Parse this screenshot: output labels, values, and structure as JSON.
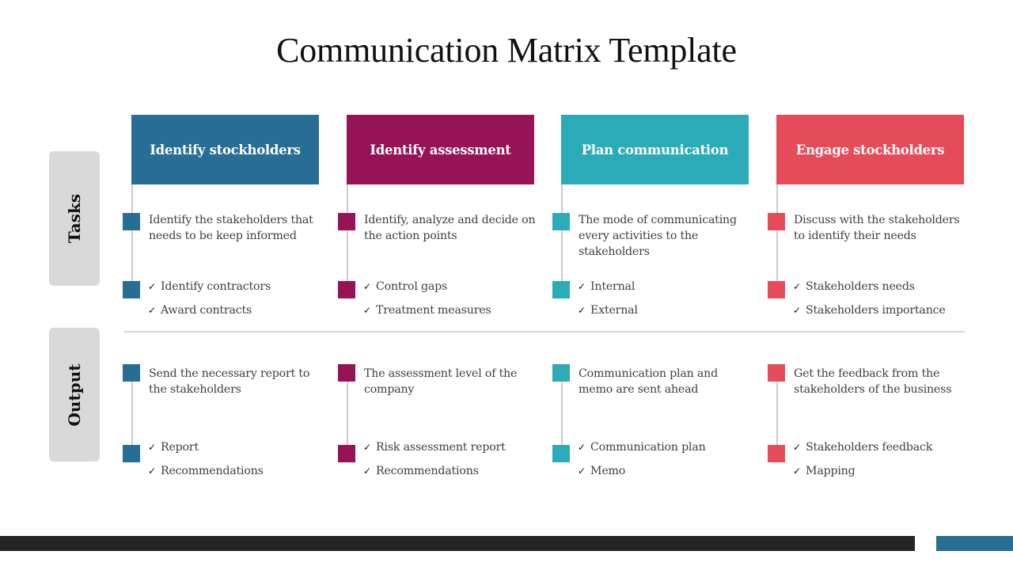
{
  "title": "Communication Matrix Template",
  "row_labels": {
    "tasks": "Tasks",
    "output": "Output"
  },
  "check_icon": "✓",
  "columns": [
    {
      "header": "Identify stockholders",
      "color": "#286d94",
      "tasks": {
        "description": "Identify the stakeholders that needs to be keep informed",
        "bullets": [
          "Identify contractors",
          "Award contracts"
        ]
      },
      "output": {
        "description": "Send the necessary report to the stakeholders",
        "bullets": [
          "Report",
          "Recommendations"
        ]
      }
    },
    {
      "header": "Identify assessment",
      "color": "#951356",
      "tasks": {
        "description": "Identify, analyze and decide on the action points",
        "bullets": [
          "Control gaps",
          "Treatment measures"
        ]
      },
      "output": {
        "description": "The assessment level of the company",
        "bullets": [
          "Risk assessment report",
          "Recommendations"
        ]
      }
    },
    {
      "header": "Plan communication",
      "color": "#2babb8",
      "tasks": {
        "description": "The mode of communicating every activities to the stakeholders",
        "bullets": [
          "Internal",
          "External"
        ]
      },
      "output": {
        "description": "Communication plan and memo are sent ahead",
        "bullets": [
          "Communication plan",
          "Memo"
        ]
      }
    },
    {
      "header": "Engage stockholders",
      "color": "#e64b5a",
      "tasks": {
        "description": "Discuss with the stakeholders to identify their needs",
        "bullets": [
          "Stakeholders needs",
          "Stakeholders importance"
        ]
      },
      "output": {
        "description": "Get the feedback from the stakeholders of the business",
        "bullets": [
          "Stakeholders feedback",
          "Mapping"
        ]
      }
    }
  ],
  "footer": {
    "dark_color": "#262626",
    "accent_color": "#286d94"
  }
}
